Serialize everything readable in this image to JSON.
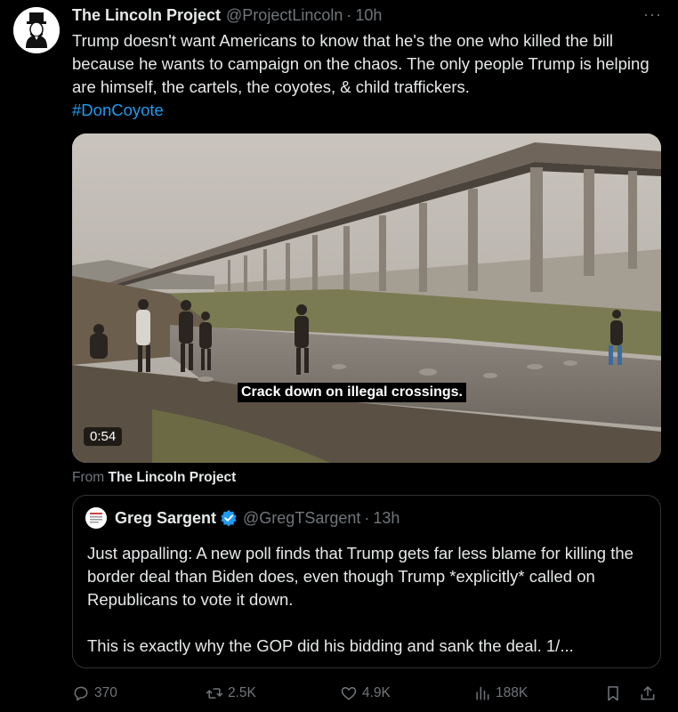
{
  "tweet": {
    "author_name": "The Lincoln Project",
    "handle": "@ProjectLincoln",
    "separator": "·",
    "time": "10h",
    "more_label": "···",
    "text": "Trump doesn't want Americans to know that he's the one who killed the bill because he wants to campaign on the chaos. The only people Trump is helping are himself, the cartels, the coyotes, & child traffickers.",
    "hashtag": "#DonCoyote"
  },
  "video": {
    "caption": "Crack down on illegal crossings.",
    "duration": "0:54"
  },
  "from": {
    "prefix": "From",
    "source": "The Lincoln Project"
  },
  "quote": {
    "author_name": "Greg Sargent",
    "handle": "@GregTSargent",
    "separator": "·",
    "time": "13h",
    "text": "Just appalling: A new poll finds that Trump gets far less blame for killing the border deal than Biden does, even though Trump *explicitly* called on Republicans to vote it down.\n\nThis is exactly why the GOP did his bidding and sank the deal. 1/..."
  },
  "actions": {
    "replies": "370",
    "reposts": "2.5K",
    "likes": "4.9K",
    "views": "188K"
  },
  "colors": {
    "background": "#000000",
    "text": "#e7e9ea",
    "muted": "#71767b",
    "accent": "#1d9bf0",
    "border": "#2f3336"
  }
}
